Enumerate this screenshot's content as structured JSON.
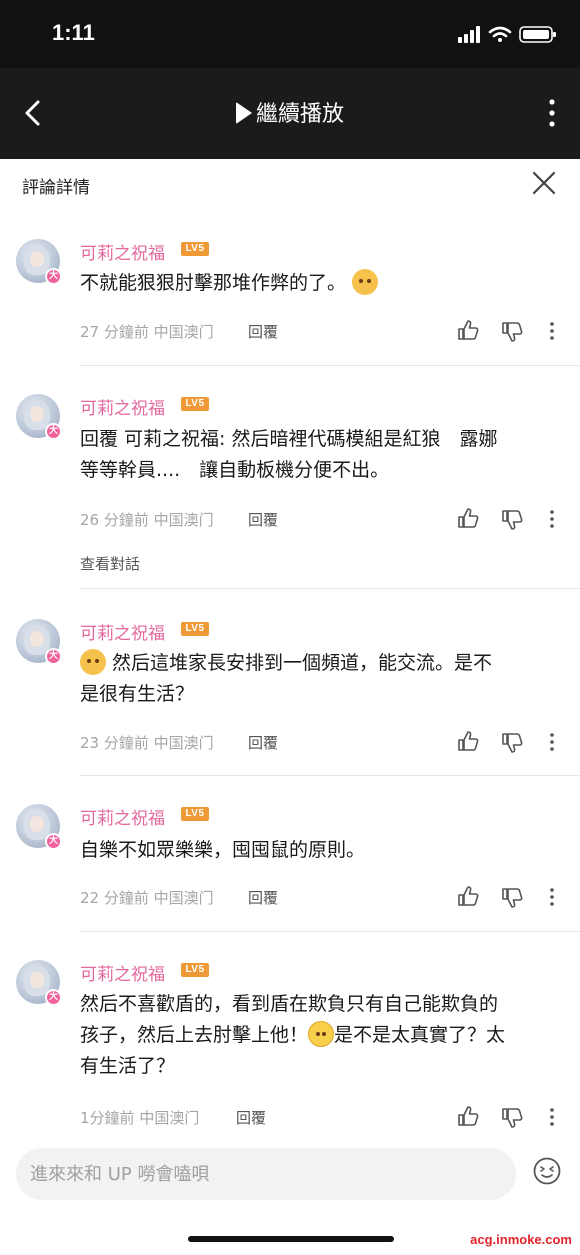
{
  "status_bar": {
    "time": "1:11"
  },
  "nav": {
    "title": "繼續播放"
  },
  "detail": {
    "title": "評論詳情"
  },
  "comments": [
    {
      "user": "可莉之祝福",
      "level": "LV5",
      "text": "不就能狠狠肘擊那堆作弊的了。",
      "time": "27 分鐘前",
      "location": "中国澳门",
      "reply": "回覆"
    },
    {
      "user": "可莉之祝福",
      "level": "LV5",
      "text_line1": "回覆 可莉之祝福: 然后暗裡代碼模組是紅狼　露娜",
      "text_line2": "等等幹員....　讓自動板機分便不出。",
      "time": "26 分鐘前",
      "location": "中国澳门",
      "reply": "回覆",
      "view_thread": "查看對話"
    },
    {
      "user": "可莉之祝福",
      "level": "LV5",
      "text_line1": "然后這堆家長安排到一個頻道，能交流。是不",
      "text_line2": "是很有生活？",
      "time": "23 分鐘前",
      "location": "中国澳门",
      "reply": "回覆"
    },
    {
      "user": "可莉之祝福",
      "level": "LV5",
      "text": "自樂不如眾樂樂，囤囤鼠的原則。",
      "time": "22 分鐘前",
      "location": "中国澳门",
      "reply": "回覆"
    },
    {
      "user": "可莉之祝福",
      "level": "LV5",
      "text_line1": "然后不喜歡盾的，看到盾在欺負只有自己能欺負的",
      "text_line2a": "孩子，然后上去肘擊上他！",
      "text_line2b": "是不是太真實了？太",
      "text_line3": "有生活了？",
      "time": "1分鐘前",
      "location": "中国澳门",
      "reply": "回覆"
    }
  ],
  "input": {
    "placeholder": "進來來和 UP 嘮會嗑唄"
  },
  "watermark": "acg.inmoke.com",
  "colors": {
    "username": "#e3689d",
    "level_badge": "#f09a37",
    "nav_bg": "#1b1b1b"
  }
}
